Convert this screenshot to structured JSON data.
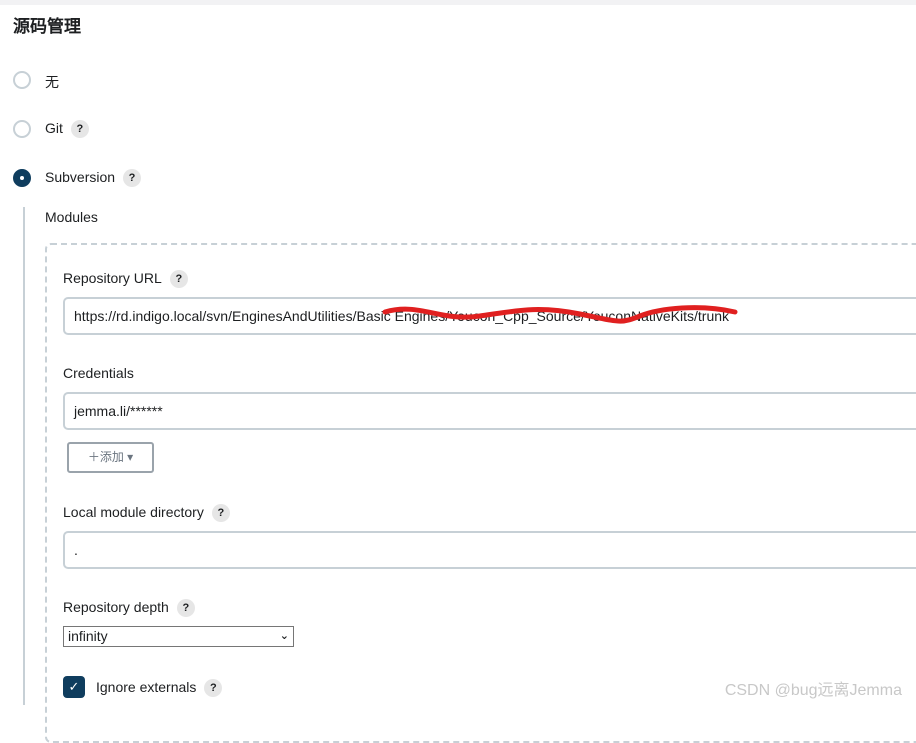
{
  "section_title": "源码管理",
  "scm_options": [
    {
      "label": "无",
      "selected": false
    },
    {
      "label": "Git",
      "selected": false,
      "help": "?"
    },
    {
      "label": "Subversion",
      "selected": true,
      "help": "?"
    }
  ],
  "modules_label": "Modules",
  "repo_url": {
    "label": "Repository URL",
    "help": "?",
    "value": "https://rd.indigo.local/svn/EnginesAndUtilities/Basic Engines/Youcon_Cpp_Source/YouconNativeKits/trunk"
  },
  "credentials": {
    "label": "Credentials",
    "value": "jemma.li/******",
    "add_button": "＋添加 ▾"
  },
  "local_dir": {
    "label": "Local module directory",
    "help": "?",
    "value": "."
  },
  "depth": {
    "label": "Repository depth",
    "help": "?",
    "value": "infinity"
  },
  "ignore_externals": {
    "label": "Ignore externals",
    "help": "?",
    "checked": true
  },
  "watermark": "CSDN @bug远离Jemma",
  "colors": {
    "accent": "#0f3d5e",
    "border": "#c7d0d6",
    "redaction": "#e02020"
  }
}
